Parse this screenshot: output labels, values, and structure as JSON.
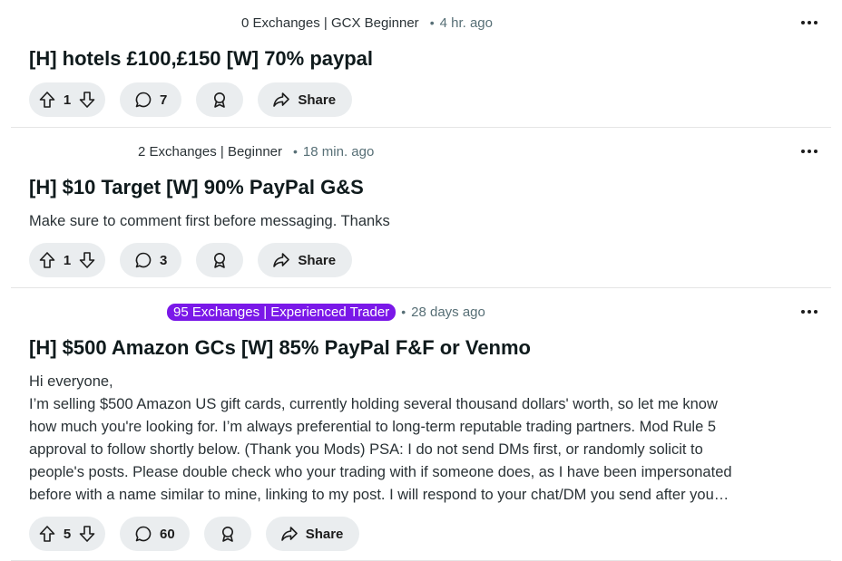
{
  "posts": [
    {
      "flair": "0 Exchanges | GCX Beginner",
      "time": "4 hr. ago",
      "title": "[H] hotels £100,£150 [W] 70% paypal",
      "body": "",
      "votes": "1",
      "comments": "7",
      "share_label": "Share"
    },
    {
      "flair": "2 Exchanges | Beginner",
      "time": "18 min. ago",
      "title": "[H] $10 Target [W] 90% PayPal G&S",
      "body": "Make sure to comment first before messaging. Thanks",
      "votes": "1",
      "comments": "3",
      "share_label": "Share"
    },
    {
      "flair": "95 Exchanges | Experienced Trader",
      "flair_color": "#7a18e8",
      "time": "28 days ago",
      "title": "[H] $500 Amazon GCs [W] 85% PayPal F&F or Venmo",
      "body_lines": [
        "Hi everyone,",
        "I’m selling $500 Amazon US gift cards, currently holding several thousand dollars' worth, so let me know",
        "how much you're looking for. I’m always preferential to long-term reputable trading partners. Mod Rule 5",
        "approval to follow shortly below. (Thank you Mods) PSA: I do not send DMs first, or randomly solicit to",
        "people's posts. Please double check who your trading with if someone does, as I have been impersonated",
        "before with a name similar to mine, linking to my post. I will respond to your chat/DM you send after you…"
      ],
      "votes": "5",
      "comments": "60",
      "share_label": "Share"
    }
  ],
  "separator": "•",
  "icons": [
    "upvote-icon",
    "downvote-icon",
    "comment-icon",
    "award-icon",
    "share-icon",
    "more-options-icon"
  ]
}
